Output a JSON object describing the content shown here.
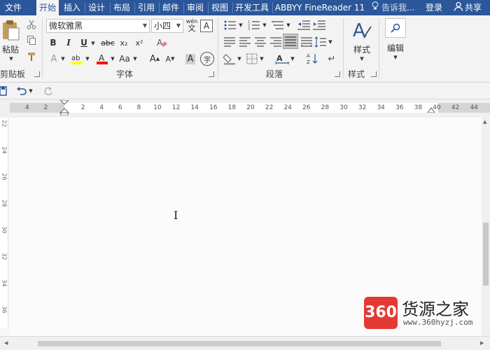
{
  "tabs": [
    "文件",
    "开始",
    "插入",
    "设计",
    "布局",
    "引用",
    "邮件",
    "审阅",
    "视图",
    "开发工具",
    "ABBYY FineReader 11"
  ],
  "active_tab": "开始",
  "tell_me": "告诉我...",
  "sign_in": "登录",
  "share": "共享",
  "ribbon": {
    "clipboard": {
      "label": "剪贴板",
      "paste": "粘贴"
    },
    "font": {
      "label": "字体",
      "font_name": "微软雅黑",
      "font_size": "小四",
      "phonetic": "wén",
      "phonetic_char": "文",
      "bold": "B",
      "italic": "I",
      "underline": "U",
      "strike": "abc",
      "subscript": "x₂",
      "superscript": "x²",
      "grow": "A",
      "shrink": "A",
      "case": "Aa",
      "enclose": "字"
    },
    "paragraph": {
      "label": "段落"
    },
    "styles": {
      "label": "样式",
      "btn": "样式"
    },
    "editing": {
      "btn": "编辑"
    }
  },
  "ruler": {
    "left_numbers": [
      "4",
      "2"
    ],
    "right_numbers": [
      "2",
      "4",
      "6",
      "8",
      "10",
      "12",
      "14",
      "16",
      "18",
      "20",
      "22",
      "24",
      "26",
      "28",
      "30",
      "32",
      "34",
      "36",
      "38",
      "40",
      "42",
      "44"
    ]
  },
  "vruler_numbers": [
    "22",
    "24",
    "26",
    "28",
    "30",
    "32",
    "34",
    "36"
  ],
  "watermark": {
    "logo": "360",
    "name": "货源之家",
    "url": "www.360hyzj.com"
  },
  "colors": {
    "accent": "#2b579a",
    "highlight": "#ffff00",
    "font_color": "#ff0000",
    "watermark": "#e53935"
  }
}
